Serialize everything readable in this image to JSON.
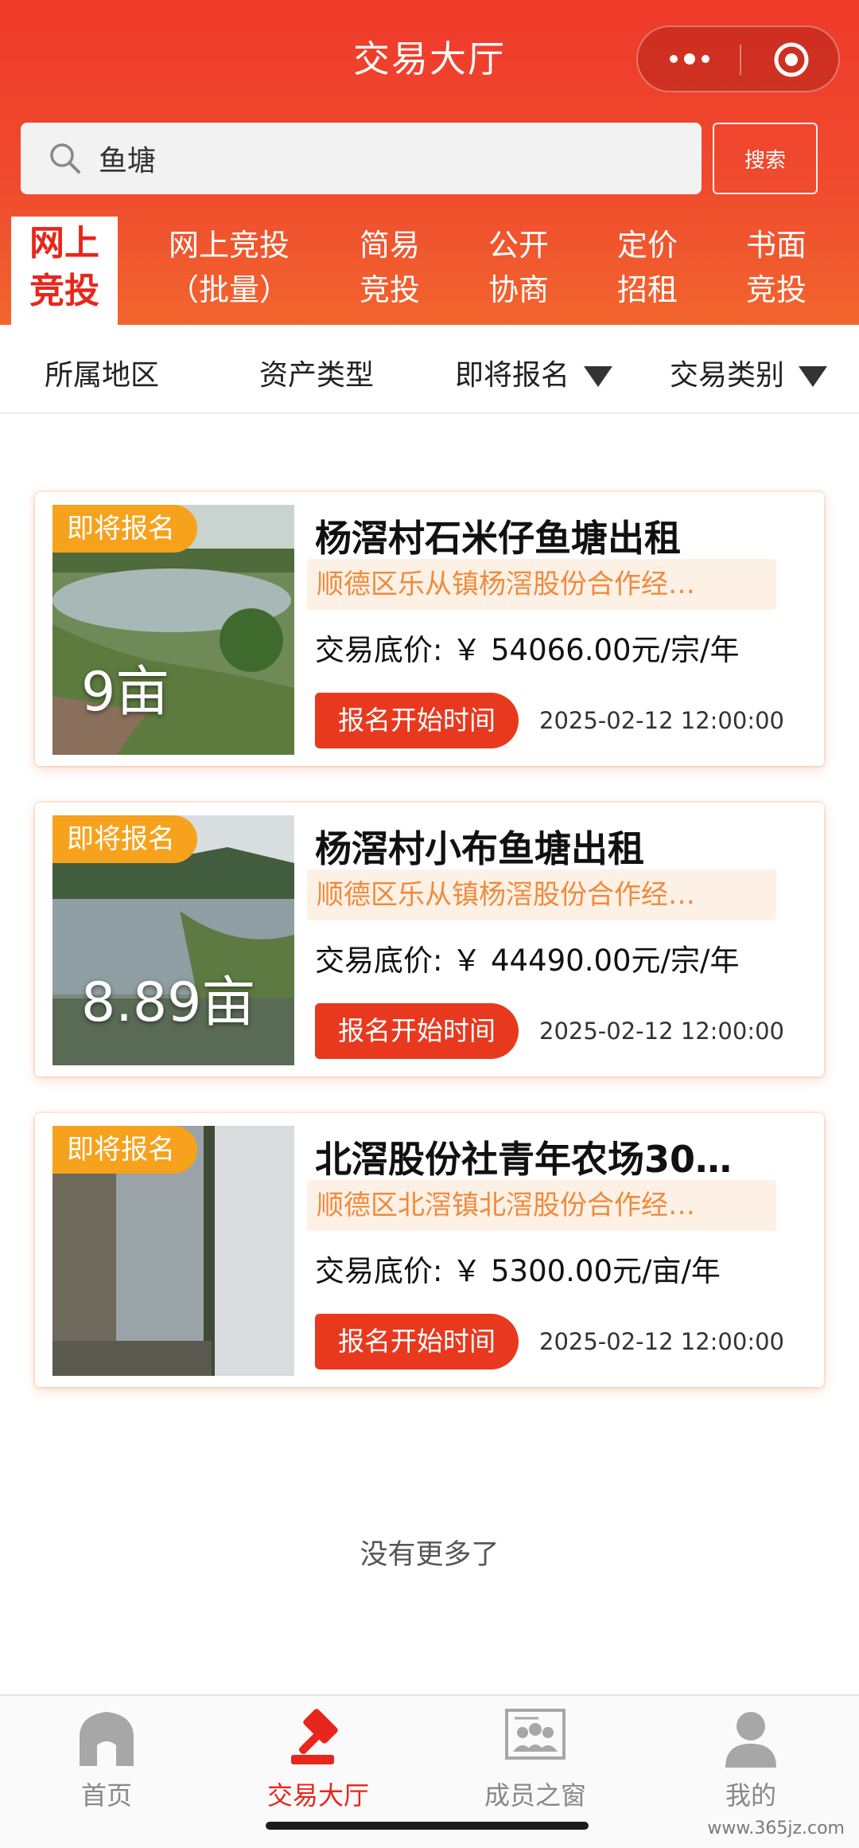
{
  "header": {
    "title": "交易大厅"
  },
  "search": {
    "value": "鱼塘",
    "button_label": "搜索"
  },
  "tabs": [
    {
      "line1": "网上",
      "line2": "竞投"
    },
    {
      "line1": "网上竞投",
      "line2": "（批量）"
    },
    {
      "line1": "简易",
      "line2": "竞投"
    },
    {
      "line1": "公开",
      "line2": "协商"
    },
    {
      "line1": "定价",
      "line2": "招租"
    },
    {
      "line1": "书面",
      "line2": "竞投"
    }
  ],
  "filters": [
    {
      "label": "所属地区"
    },
    {
      "label": "资产类型"
    },
    {
      "label": "即将报名"
    },
    {
      "label": "交易类别"
    }
  ],
  "listings": [
    {
      "badge": "即将报名",
      "area": "9亩",
      "title": "杨滘村石米仔鱼塘出租",
      "org": "顺德区乐从镇杨滘股份合作经…",
      "price": "交易底价: ￥ 54066.00元/宗/年",
      "button": "报名开始时间",
      "time": "2025-02-12 12:00:00"
    },
    {
      "badge": "即将报名",
      "area": "8.89亩",
      "title": "杨滘村小布鱼塘出租",
      "org": "顺德区乐从镇杨滘股份合作经…",
      "price": "交易底价: ￥ 44490.00元/宗/年",
      "button": "报名开始时间",
      "time": "2025-02-12 12:00:00"
    },
    {
      "badge": "即将报名",
      "area": "",
      "title": "北滘股份社青年农场30…",
      "org": "顺德区北滘镇北滘股份合作经…",
      "price": "交易底价: ￥ 5300.00元/亩/年",
      "button": "报名开始时间",
      "time": "2025-02-12 12:00:00"
    }
  ],
  "footer": {
    "no_more": "没有更多了"
  },
  "tabbar": [
    {
      "label": "首页",
      "icon": "home-icon"
    },
    {
      "label": "交易大厅",
      "icon": "gavel-icon"
    },
    {
      "label": "成员之窗",
      "icon": "members-icon"
    },
    {
      "label": "我的",
      "icon": "user-icon"
    }
  ],
  "watermark": "www.365jz.com",
  "colors": {
    "primary": "#e8261c",
    "badge": "#f6a21c",
    "org_text": "#f08a3c"
  }
}
